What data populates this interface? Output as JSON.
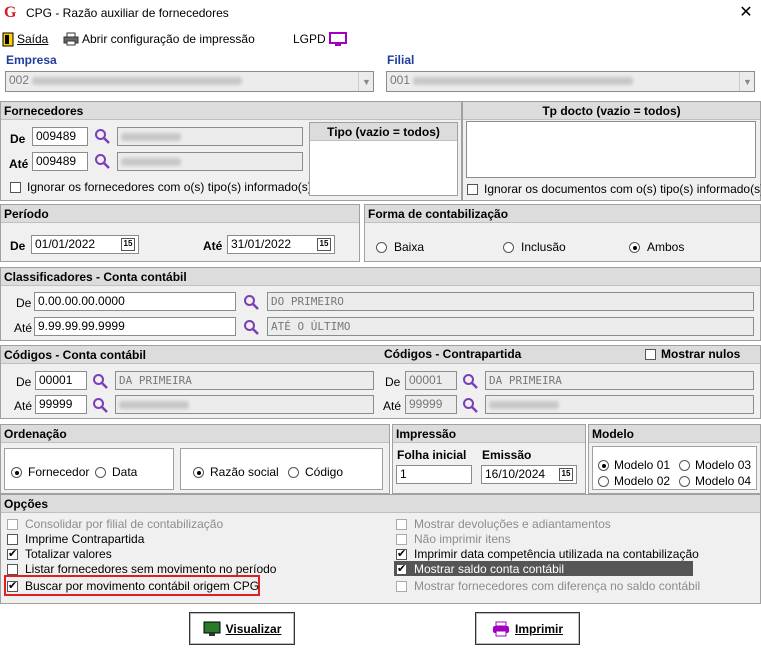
{
  "window": {
    "title": "CPG - Razão auxiliar de fornecedores",
    "app_icon": "G"
  },
  "toolbar": {
    "exit_label": "Saída",
    "print_config_label": "Abrir configuração de impressão",
    "lgpd_label": "LGPD"
  },
  "empresa": {
    "label": "Empresa",
    "value": "002"
  },
  "filial": {
    "label": "Filial",
    "value": "001"
  },
  "fornecedores": {
    "title": "Fornecedores",
    "de_label": "De",
    "de_value": "009489",
    "ate_label": "Até",
    "ate_value": "009489",
    "ignore_label": "Ignorar os fornecedores com o(s) tipo(s) informado(s)",
    "tipo_title": "Tipo (vazio = todos)"
  },
  "tp_docto": {
    "title": "Tp docto (vazio = todos)",
    "ignore_label": "Ignorar os documentos com o(s) tipo(s) informado(s)"
  },
  "periodo": {
    "title": "Período",
    "de_label": "De",
    "de_value": "01/01/2022",
    "ate_label": "Até",
    "ate_value": "31/01/2022",
    "cal_label": "15"
  },
  "forma": {
    "title": "Forma de contabilização",
    "opt1": "Baixa",
    "opt2": "Inclusão",
    "opt3": "Ambos",
    "selected": "Ambos"
  },
  "classificadores": {
    "title": "Classificadores - Conta contábil",
    "de_label": "De",
    "de_value": "0.00.00.00.0000",
    "de_desc": "DO PRIMEIRO",
    "ate_label": "Até",
    "ate_value": "9.99.99.99.9999",
    "ate_desc": "ATÉ O ÚLTIMO"
  },
  "codigos_conta": {
    "title": "Códigos - Conta contábil",
    "de_label": "De",
    "de_value": "00001",
    "de_desc": "DA PRIMEIRA",
    "ate_label": "Até",
    "ate_value": "99999"
  },
  "codigos_contra": {
    "title": "Códigos - Contrapartida",
    "de_label": "De",
    "de_value": "00001",
    "de_desc": "DA PRIMEIRA",
    "ate_label": "Até",
    "ate_value": "99999",
    "mostrar_nulos": "Mostrar nulos"
  },
  "ordenacao": {
    "title": "Ordenação",
    "opt_fornecedor": "Fornecedor",
    "opt_data": "Data",
    "opt_razao": "Razão social",
    "opt_codigo": "Código"
  },
  "impressao": {
    "title": "Impressão",
    "folha_label": "Folha inicial",
    "folha_value": "1",
    "emissao_label": "Emissão",
    "emissao_value": "16/10/2024",
    "cal_label": "15"
  },
  "modelo": {
    "title": "Modelo",
    "m1": "Modelo 01",
    "m2": "Modelo 02",
    "m3": "Modelo 03",
    "m4": "Modelo 04"
  },
  "opcoes": {
    "title": "Opções",
    "left": [
      {
        "label": "Consolidar por filial de contabilização",
        "checked": false,
        "disabled": true
      },
      {
        "label": "Imprime Contrapartida",
        "checked": false,
        "disabled": false
      },
      {
        "label": "Totalizar valores",
        "checked": true,
        "disabled": false
      },
      {
        "label": "Listar fornecedores sem movimento no período",
        "checked": false,
        "disabled": false
      },
      {
        "label": "Buscar por movimento contábil origem CPG",
        "checked": true,
        "disabled": false
      }
    ],
    "right": [
      {
        "label": "Mostrar devoluções e adiantamentos",
        "checked": false,
        "disabled": true
      },
      {
        "label": "Não imprimir itens",
        "checked": false,
        "disabled": true
      },
      {
        "label": "Imprimir data competência utilizada na contabilização",
        "checked": true,
        "disabled": false
      },
      {
        "label": "Mostrar saldo conta contábil",
        "checked": true,
        "disabled": false
      },
      {
        "label": "Mostrar fornecedores com diferença no saldo contábil",
        "checked": false,
        "disabled": true
      }
    ]
  },
  "buttons": {
    "visualizar": "Visualizar",
    "imprimir": "Imprimir"
  },
  "colors": {
    "highlight_border": "#e02020",
    "selected_row": "#555555",
    "brand": "#d71920"
  }
}
